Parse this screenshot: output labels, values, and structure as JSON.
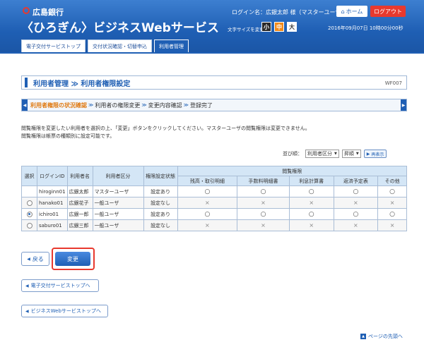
{
  "header": {
    "bank_name": "広島銀行",
    "service_name": "〈ひろぎん〉ビジネスWebサービス",
    "login_name": "ログイン名：広銀太郎 様（マスターユーザ）",
    "home_label": "ホーム",
    "logout_label": "ログアウト",
    "font_size_label": "文字サイズを変更",
    "font_sizes": [
      "小",
      "中",
      "大"
    ],
    "datetime": "2016年09月07日 10時00分00秒"
  },
  "tabs": [
    "電子交付サービストップ",
    "交付状況確認・切替申込",
    "利用者管理"
  ],
  "page": {
    "title": "利用者管理 ≫ 利用者権限設定",
    "screen_id": "WF007"
  },
  "steps": [
    "利用者権限の状況確認",
    "利用者の権限変更",
    "変更内容確認",
    "登録完了"
  ],
  "description": [
    "閲覧権限を変更したい利用者を選択の上、「変更」ボタンをクリックしてください。マスターユーザの閲覧権限は変更できません。",
    "閲覧権限は帳票の種類別に設定可能です。"
  ],
  "sort": {
    "label": "並び順：",
    "field": "利用者区分",
    "order": "昇順",
    "redisplay_label": "再表示"
  },
  "table": {
    "headers": {
      "select": "選択",
      "login_id": "ログインID",
      "user_name": "利用者名",
      "user_type": "利用者区分",
      "perm_state": "権限設定状態",
      "view_perm": "閲覧権限",
      "perm_cols": [
        "残高・取引明細",
        "手数料明細書",
        "利息計算書",
        "返済予定表",
        "その他"
      ]
    },
    "rows": [
      {
        "login_id": "hiroginn01",
        "user_name": "広銀太郎",
        "user_type": "マスターユーザ",
        "state": "設定あり",
        "perms": [
          "○",
          "○",
          "○",
          "○",
          "○"
        ],
        "radio": "none"
      },
      {
        "login_id": "hanako01",
        "user_name": "広銀花子",
        "user_type": "一般ユーザ",
        "state": "設定なし",
        "perms": [
          "×",
          "×",
          "×",
          "×",
          "×"
        ],
        "radio": "off"
      },
      {
        "login_id": "ichiro01",
        "user_name": "広銀一郎",
        "user_type": "一般ユーザ",
        "state": "設定あり",
        "perms": [
          "○",
          "○",
          "○",
          "○",
          "○"
        ],
        "radio": "on"
      },
      {
        "login_id": "saburo01",
        "user_name": "広銀三郎",
        "user_type": "一般ユーザ",
        "state": "設定なし",
        "perms": [
          "×",
          "×",
          "×",
          "×",
          "×"
        ],
        "radio": "off"
      }
    ]
  },
  "buttons": {
    "back": "戻る",
    "change": "変更",
    "to_denshi_top": "電子交付サービストップへ",
    "to_business_top": "ビジネスWebサービストップへ",
    "page_top": "ページの先頭へ"
  }
}
